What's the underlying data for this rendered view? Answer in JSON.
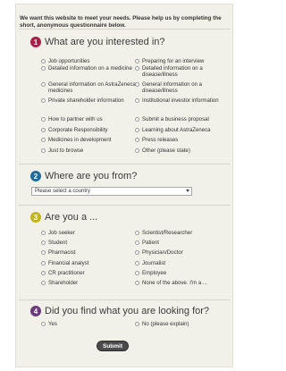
{
  "intro": "We want this website to meet your needs. Please help us by completing the short, anonymous questionnaire below.",
  "colors": {
    "section1": "#a81f47",
    "section2": "#1f6b9c",
    "section3": "#c2b51d",
    "section4": "#6b3a7a",
    "panel_bg": "#f2f1e9"
  },
  "sections": [
    {
      "number": "1",
      "title": "What are you interested in?",
      "left": [
        "Job opportunities",
        "Detailed information on a medicine",
        "General information on AstraZeneca medicines",
        "Private shareholder information",
        "How to partner with us",
        "Corporate Responsibility",
        "Medicines in development",
        "Just to browse"
      ],
      "right": [
        "Preparing for an interview",
        "Detailed information on a disease/illness",
        "General information on a disease/illness",
        "Institutional investor information",
        "Submit a business proposal",
        "Learning about AstraZeneca",
        "Press releases",
        "Other (please state)"
      ]
    },
    {
      "number": "2",
      "title": "Where are you from?",
      "select_value": "Please select a country"
    },
    {
      "number": "3",
      "title": "Are you a ...",
      "left": [
        "Job seeker",
        "Student",
        "Pharmacist",
        "Financial analyst",
        "CR practitioner",
        "Shareholder"
      ],
      "right": [
        "Scientist/Researcher",
        "Patient",
        "Physician/Doctor",
        "Journalist",
        "Employee",
        "None of the above. I'm a ..."
      ]
    },
    {
      "number": "4",
      "title": "Did you find what you are looking for?",
      "left": [
        "Yes"
      ],
      "right": [
        "No (please explain)"
      ]
    }
  ],
  "submit_label": "Submit"
}
